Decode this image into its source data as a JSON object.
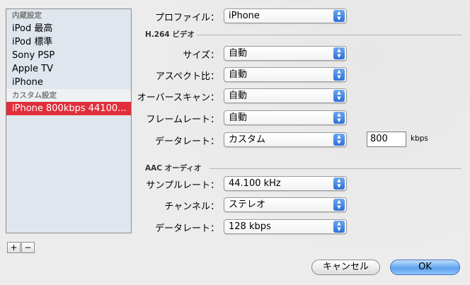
{
  "presets": {
    "builtin_header": "内蔵設定",
    "builtin": [
      "iPod 最高",
      "iPod 標準",
      "Sony PSP",
      "Apple TV",
      "iPhone"
    ],
    "custom_header": "カスタム設定",
    "custom": [
      "iPhone 800kbps 44100..."
    ],
    "selected": "iPhone 800kbps 44100...",
    "add_label": "+",
    "remove_label": "−"
  },
  "profile": {
    "label": "プロファイル：",
    "value": "iPhone"
  },
  "video": {
    "header": "H.264 ビデオ",
    "size": {
      "label": "サイズ：",
      "value": "自動"
    },
    "aspect": {
      "label": "アスペクト比：",
      "value": "自動"
    },
    "overscan": {
      "label": "オーバースキャン：",
      "value": "自動"
    },
    "framerate": {
      "label": "フレームレート：",
      "value": "自動"
    },
    "datarate": {
      "label": "データレート：",
      "value": "カスタム",
      "custom_value": "800",
      "unit": "kbps"
    }
  },
  "audio": {
    "header": "AAC オーディオ",
    "samplerate": {
      "label": "サンプルレート：",
      "value": "44.100 kHz"
    },
    "channels": {
      "label": "チャンネル：",
      "value": "ステレオ"
    },
    "datarate": {
      "label": "データレート：",
      "value": "128 kbps"
    }
  },
  "buttons": {
    "cancel": "キャンセル",
    "ok": "OK"
  },
  "colors": {
    "selection": "#e02f3a",
    "accent": "#2d6fd8"
  }
}
